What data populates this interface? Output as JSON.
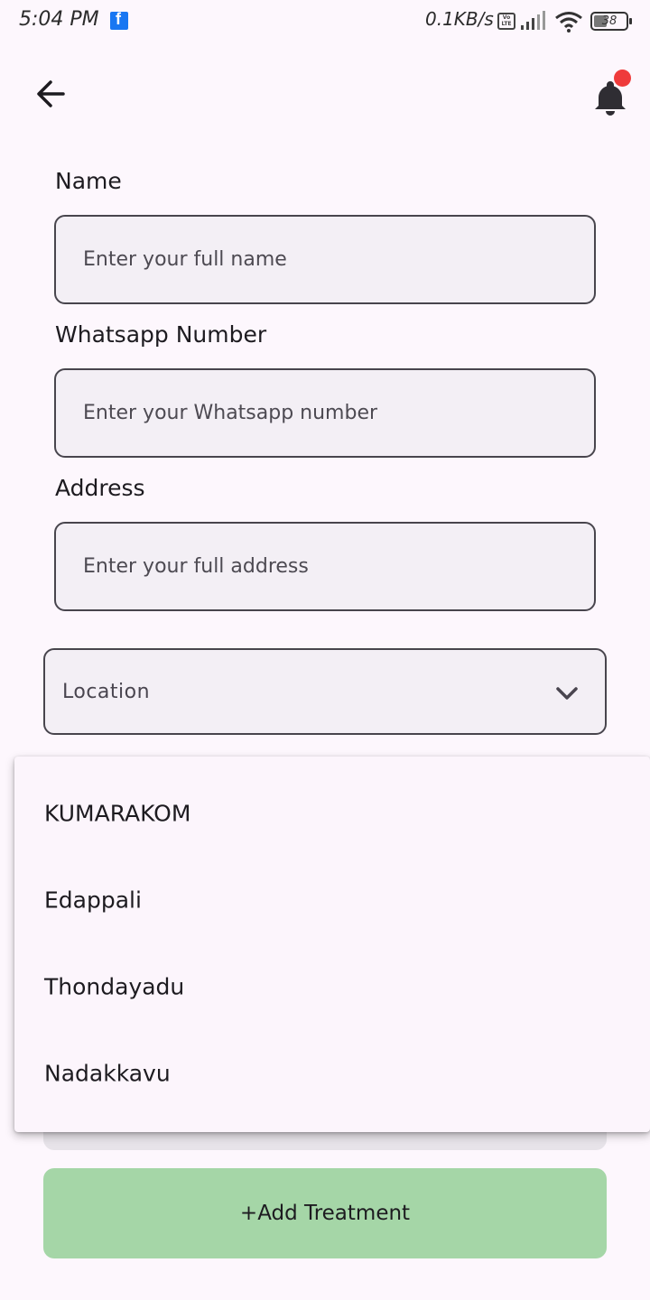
{
  "status_bar": {
    "time": "5:04 PM",
    "network_speed": "0.1KB/s",
    "volte_label": "Vo LTE",
    "battery_level": "38",
    "icons": [
      "facebook-icon",
      "volte-icon",
      "signal-icon",
      "wifi-icon",
      "battery-icon"
    ]
  },
  "app_bar": {
    "back_icon": "arrow-left-icon",
    "notification_icon": "bell-icon",
    "notification_badge_color": "#ef3b3b"
  },
  "form": {
    "name": {
      "label": "Name",
      "placeholder": "Enter your full name",
      "value": ""
    },
    "whatsapp": {
      "label": "Whatsapp Number",
      "placeholder": "Enter your Whatsapp number",
      "value": ""
    },
    "address": {
      "label": "Address",
      "placeholder": "Enter your full address",
      "value": ""
    },
    "location": {
      "label": "Location",
      "icon": "chevron-down-icon"
    }
  },
  "location_menu": {
    "options": [
      "KUMARAKOM",
      "Edappali",
      "Thondayadu",
      "Nadakkavu"
    ]
  },
  "actions": {
    "add_treatment_label": "+Add Treatment",
    "add_treatment_color": "#a5d6a7"
  }
}
